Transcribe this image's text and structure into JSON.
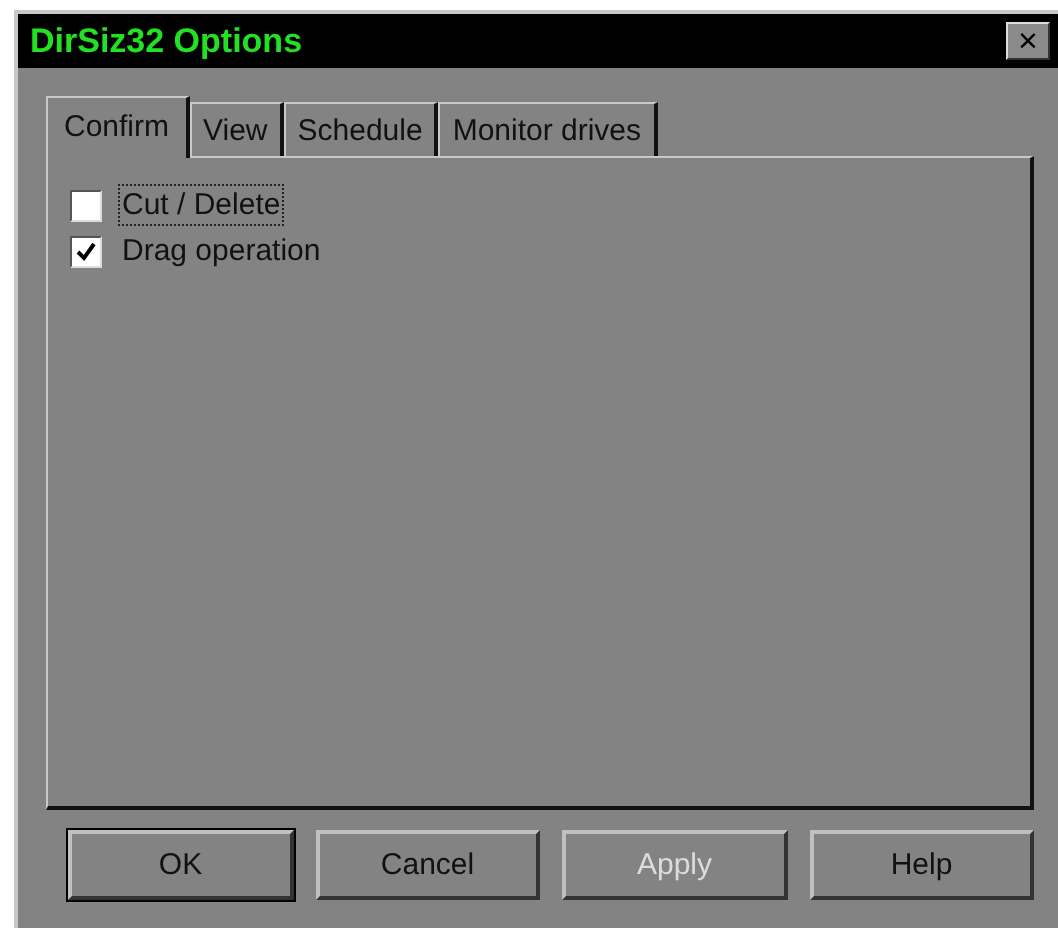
{
  "window": {
    "title": "DirSiz32 Options",
    "close": "×"
  },
  "tabs": [
    {
      "label": "Confirm",
      "selected": true
    },
    {
      "label": "View",
      "selected": false
    },
    {
      "label": "Schedule",
      "selected": false
    },
    {
      "label": "Monitor drives",
      "selected": false
    }
  ],
  "options": [
    {
      "label": "Cut / Delete",
      "checked": false,
      "focused": true
    },
    {
      "label": "Drag operation",
      "checked": true,
      "focused": false
    }
  ],
  "buttons": [
    {
      "label": "OK",
      "default": true,
      "disabled": false
    },
    {
      "label": "Cancel",
      "default": false,
      "disabled": false
    },
    {
      "label": "Apply",
      "default": false,
      "disabled": true
    },
    {
      "label": "Help",
      "default": false,
      "disabled": false
    }
  ]
}
